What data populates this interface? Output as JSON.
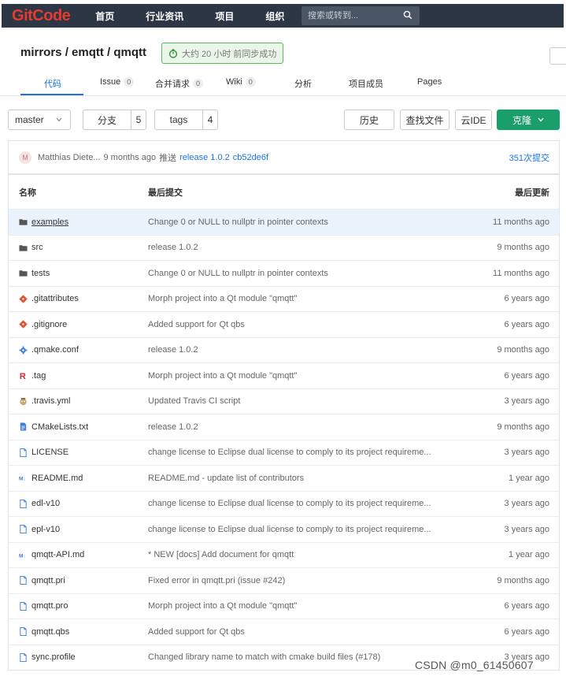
{
  "nav": {
    "logo_g": "G",
    "logo_rest": "itCode",
    "items": [
      "首页",
      "行业资讯",
      "项目",
      "组织"
    ],
    "search_placeholder": "搜索或转到..."
  },
  "project": {
    "title": "mirrors / emqtt / qmqtt",
    "sync_status": "大约 20 小时 前同步成功"
  },
  "tabs": [
    {
      "label": "代码",
      "count": ""
    },
    {
      "label": "Issue",
      "count": "0"
    },
    {
      "label": "合并请求",
      "count": "0"
    },
    {
      "label": "Wiki",
      "count": "0"
    },
    {
      "label": "分析",
      "count": ""
    },
    {
      "label": "项目成员",
      "count": ""
    },
    {
      "label": "Pages",
      "count": ""
    }
  ],
  "toolbar": {
    "branch": "master",
    "branches_label": "分支",
    "branches_count": "5",
    "tags_label": "tags",
    "tags_count": "4",
    "history": "历史",
    "find_file": "查找文件",
    "cloud_ide": "云IDE",
    "clone": "克隆"
  },
  "last_commit": {
    "avatar": "M",
    "author": "Matthias Diete...",
    "time": "9 months ago",
    "action": "推送",
    "message": "release 1.0.2",
    "sha": "cb52de6f",
    "commit_count": "351次提交"
  },
  "table": {
    "headers": {
      "name": "名称",
      "last_commit": "最后提交",
      "last_update": "最后更新"
    },
    "rows": [
      {
        "name": "examples",
        "icon": "folder-icon",
        "message": "Change 0 or NULL to nullptr in pointer contexts",
        "date": "11 months ago"
      },
      {
        "name": "src",
        "icon": "folder-icon",
        "message": "release 1.0.2",
        "date": "9 months ago"
      },
      {
        "name": "tests",
        "icon": "folder-icon",
        "message": "Change 0 or NULL to nullptr in pointer contexts",
        "date": "11 months ago"
      },
      {
        "name": ".gitattributes",
        "icon": "git-icon",
        "message": "Morph project into a Qt module \"qmqtt\"",
        "date": "6 years ago"
      },
      {
        "name": ".gitignore",
        "icon": "git-icon",
        "message": "Added support for Qt qbs",
        "date": "6 years ago"
      },
      {
        "name": ".qmake.conf",
        "icon": "gear-icon",
        "message": "release 1.0.2",
        "date": "9 months ago"
      },
      {
        "name": ".tag",
        "icon": "r-icon",
        "message": "Morph project into a Qt module \"qmqtt\"",
        "date": "6 years ago"
      },
      {
        "name": ".travis.yml",
        "icon": "travis-icon",
        "message": "Updated Travis CI script",
        "date": "3 years ago"
      },
      {
        "name": "CMakeLists.txt",
        "icon": "text-file-icon",
        "message": "release 1.0.2",
        "date": "9 months ago"
      },
      {
        "name": "LICENSE",
        "icon": "file-icon",
        "message": "change license to Eclipse dual license to comply to its project requireme...",
        "date": "3 years ago"
      },
      {
        "name": "README.md",
        "icon": "markdown-icon",
        "message": "README.md - update list of contributors",
        "date": "1 year ago"
      },
      {
        "name": "edl-v10",
        "icon": "file-icon",
        "message": "change license to Eclipse dual license to comply to its project requireme...",
        "date": "3 years ago"
      },
      {
        "name": "epl-v10",
        "icon": "file-icon",
        "message": "change license to Eclipse dual license to comply to its project requireme...",
        "date": "3 years ago"
      },
      {
        "name": "qmqtt-API.md",
        "icon": "markdown-icon",
        "message": "* NEW [docs] Add document for qmqtt",
        "date": "1 year ago"
      },
      {
        "name": "qmqtt.pri",
        "icon": "file-icon",
        "message": "Fixed error in qmqtt.pri (issue #242)",
        "date": "9 months ago"
      },
      {
        "name": "qmqtt.pro",
        "icon": "file-icon",
        "message": "Morph project into a Qt module \"qmqtt\"",
        "date": "6 years ago"
      },
      {
        "name": "qmqtt.qbs",
        "icon": "file-icon",
        "message": "Added support for Qt qbs",
        "date": "6 years ago"
      },
      {
        "name": "sync.profile",
        "icon": "file-icon",
        "message": "Changed library name to match with cmake build files (#178)",
        "date": "3 years ago"
      }
    ]
  },
  "watermark": "CSDN @m0_61450607",
  "colors": {
    "nav_bg": "#2c3645",
    "logo": "#e63b2e",
    "accent": "#1a73e8",
    "clone_bg": "#1a9e6a",
    "highlight_row": "#eaf3fc"
  }
}
